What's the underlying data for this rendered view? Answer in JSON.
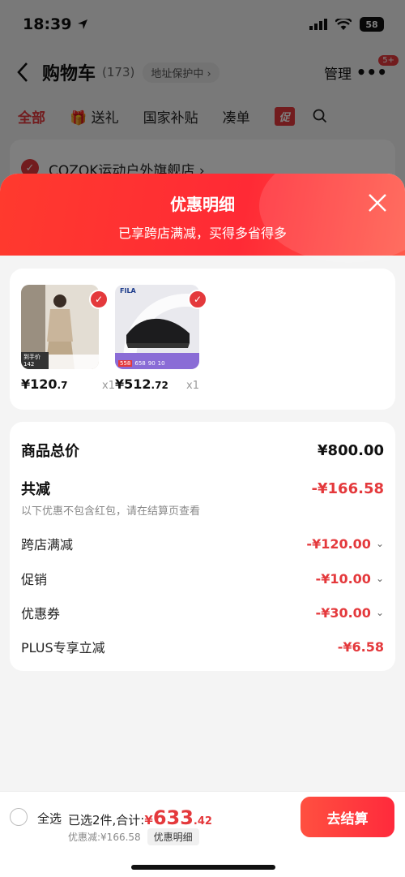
{
  "status_bar": {
    "time": "18:39",
    "battery": "58"
  },
  "nav": {
    "back_icon": "chevron-left-icon",
    "title": "购物车",
    "count": "(173)",
    "address_badge": "地址保护中 ›",
    "manage": "管理",
    "more": "•••",
    "notification_badge": "5+"
  },
  "tabs": [
    {
      "label": "全部"
    },
    {
      "label": "送礼"
    },
    {
      "label": "国家补贴"
    },
    {
      "label": "凑单"
    },
    {
      "label": "促"
    }
  ],
  "store": {
    "name": "COZOK运动户外旗舰店 ›"
  },
  "sheet": {
    "title": "优惠明细",
    "subtitle": "已享跨店满减，买得多省得多",
    "close_icon": "close-icon"
  },
  "products": [
    {
      "price_symbol": "¥",
      "price_int": "120",
      "price_dec": ".7",
      "qty": "x1",
      "thumb_badge": "到手价",
      "thumb_sub": "142"
    },
    {
      "price_symbol": "¥",
      "price_int": "512",
      "price_dec": ".72",
      "qty": "x1",
      "thumb_brand": "FILA",
      "thumb_tags": [
        "558",
        "658",
        "90",
        "10"
      ]
    }
  ],
  "details": {
    "subtotal_label": "商品总价",
    "subtotal_value": "¥800.00",
    "total_discount_label": "共减",
    "total_discount_value": "-¥166.58",
    "note": "以下优惠不包含红包，请在结算页查看",
    "items": [
      {
        "label": "跨店满减",
        "value": "-¥120.00",
        "expandable": true
      },
      {
        "label": "促销",
        "value": "-¥10.00",
        "expandable": true
      },
      {
        "label": "优惠券",
        "value": "-¥30.00",
        "expandable": true
      },
      {
        "label": "PLUS专享立减",
        "value": "-¥6.58",
        "expandable": false
      }
    ]
  },
  "checkout": {
    "select_all": "全选",
    "selected": "已选2件,合计:",
    "total_symbol": "¥",
    "total_int": "633",
    "total_dec": ".42",
    "discount": "优惠减:¥166.58",
    "detail_link": "优惠明细",
    "button": "去结算"
  },
  "colors": {
    "accent": "#e4393c",
    "sheet_header": "#ff2a35"
  }
}
